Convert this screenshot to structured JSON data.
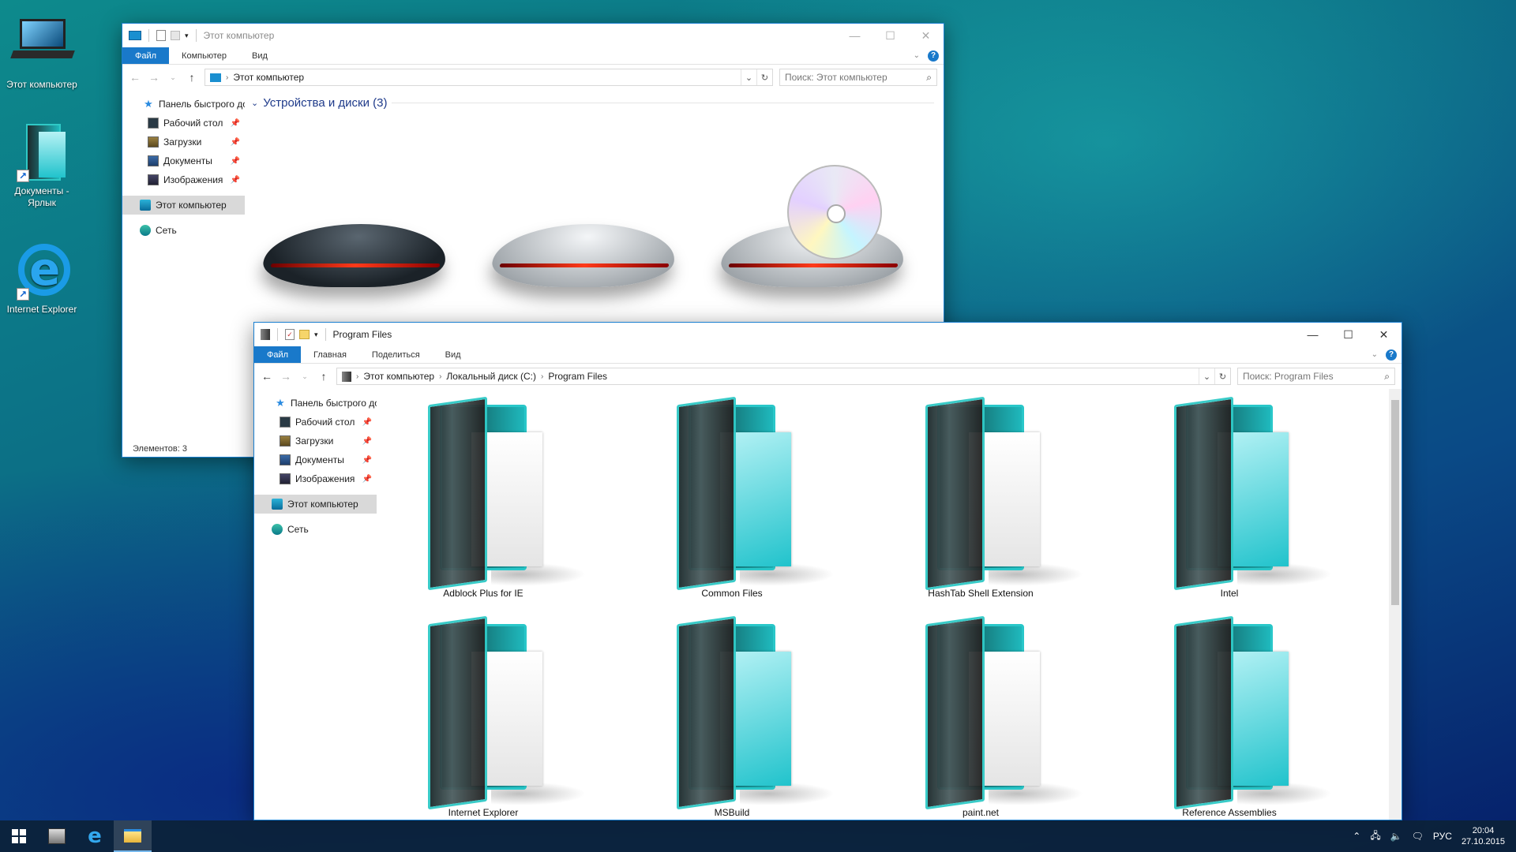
{
  "desktop": {
    "icons": [
      {
        "label": "Этот компьютер"
      },
      {
        "label": "Документы - Ярлык"
      },
      {
        "label": "Internet Explorer"
      }
    ]
  },
  "window_back": {
    "title": "Этот компьютер",
    "ribbon": {
      "file": "Файл",
      "tabs": [
        "Компьютер",
        "Вид"
      ]
    },
    "address": "Этот компьютер",
    "search_placeholder": "Поиск: Этот компьютер",
    "sidebar": {
      "quick_access": "Панель быстрого доступа",
      "items": [
        "Рабочий стол",
        "Загрузки",
        "Документы",
        "Изображения"
      ],
      "this_pc": "Этот компьютер",
      "network": "Сеть"
    },
    "group_header": "Устройства и диски (3)",
    "status": "Элементов: 3"
  },
  "window_front": {
    "title": "Program Files",
    "ribbon": {
      "file": "Файл",
      "tabs": [
        "Главная",
        "Поделиться",
        "Вид"
      ]
    },
    "breadcrumbs": [
      "Этот компьютер",
      "Локальный диск (C:)",
      "Program Files"
    ],
    "search_placeholder": "Поиск: Program Files",
    "sidebar": {
      "quick_access": "Панель быстрого доступа",
      "items": [
        "Рабочий стол",
        "Загрузки",
        "Документы",
        "Изображения"
      ],
      "this_pc": "Этот компьютер",
      "network": "Сеть"
    },
    "folders": [
      {
        "name": "Adblock Plus for IE",
        "paper": "white"
      },
      {
        "name": "Common Files",
        "paper": "cyan"
      },
      {
        "name": "HashTab Shell Extension",
        "paper": "white"
      },
      {
        "name": "Intel",
        "paper": "cyan"
      },
      {
        "name": "Internet Explorer",
        "paper": "white"
      },
      {
        "name": "MSBuild",
        "paper": "cyan"
      },
      {
        "name": "paint.net",
        "paper": "white"
      },
      {
        "name": "Reference Assemblies",
        "paper": "cyan"
      }
    ]
  },
  "taskbar": {
    "language": "РУС",
    "time": "20:04",
    "date": "27.10.2015"
  },
  "colors": {
    "accent": "#1979ca",
    "selection": "#d9d9d9"
  }
}
